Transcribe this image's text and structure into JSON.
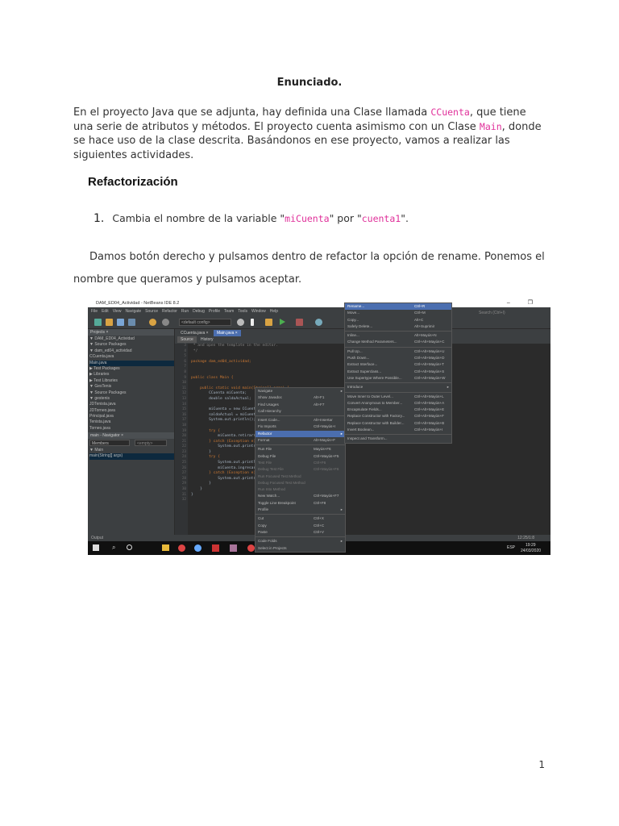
{
  "document": {
    "title": "Enunciado.",
    "para1": {
      "t1": "En el proyecto Java que se adjunta, hay definida una Clase llamada ",
      "c1": "CCuenta",
      "t2": ", que tiene una serie de atributos y métodos. El proyecto cuenta asimismo con un Clase ",
      "c2": "Main",
      "t3": ", donde se hace uso de la clase descrita. Basándonos en ese proyecto, vamos a realizar las siguientes actividades."
    },
    "heading": "Refactorización",
    "item1": {
      "number": "1.",
      "t1": "Cambia el nombre de la variable \"",
      "c1": "miCuenta",
      "t2": "\" por \"",
      "c2": "cuenta1",
      "t3": "\"."
    },
    "para2": "Damos botón derecho y pulsamos dentro de refactor la opción de rename. Ponemos el nombre que queramos y pulsamos aceptar.",
    "page_number": "1"
  },
  "screenshot": {
    "window_title": "DAM_ED04_Actividad - NetBeans IDE 8.2",
    "window_controls": "– ❐",
    "menu": [
      "File",
      "Edit",
      "View",
      "Navigate",
      "Source",
      "Refactor",
      "Run",
      "Debug",
      "Profile",
      "Team",
      "Tools",
      "Window",
      "Help"
    ],
    "config": "<default config>",
    "search_placeholder": "Search (Ctrl+I)",
    "projects_tab": "Projects ×",
    "project_tree": [
      "▼ DAM_ED04_Actividad",
      "  ▼ Source Packages",
      "    ▼ dam_ed04_actividad",
      "       CCuenta.java",
      "       Main.java",
      "  ▶ Test Packages",
      "  ▶ Libraries",
      "  ▶ Test Libraries",
      "▼ GesTenis",
      "  ▼ Source Packages",
      "    ▼ gestenis",
      "       JDTenista.java",
      "       JDTorneo.java",
      "       Principal.java",
      "       Tenista.java",
      "       Torneo.java"
    ],
    "navigator_tab": "main - Navigator ×",
    "navigator_members": "Members",
    "navigator_empty": "<empty>",
    "navigator_tree": [
      "▼ Main",
      "    main(String[] args)"
    ],
    "editor_tabs": [
      "CCuenta.java ×",
      "Main.java ×"
    ],
    "source_tab": "Source",
    "history_tab": "History",
    "line_numbers": [
      "3",
      "4",
      "5",
      "6",
      "7",
      "8",
      "9",
      "10",
      "11",
      "12",
      "13",
      "14",
      "15",
      "16",
      "17",
      "18",
      "19",
      "20",
      "21",
      "22",
      "23",
      "24",
      "25",
      "26",
      "27",
      "28",
      "29",
      "30",
      "31",
      "32"
    ],
    "code_lines": [
      " * and open the template in the editor.",
      " */",
      "",
      "package dam_ed04_actividad;",
      "",
      "",
      "public class Main {",
      "",
      "    public static void main(String[] args) {",
      "        CCuenta miCuenta;",
      "        double saldoActual;",
      "",
      "        miCuenta = new CCuenta();",
      "        saldoActual = miCuenta.estado();",
      "        System.out.println();",
      "",
      "        try {",
      "            miCuenta.retirar();",
      "        } catch (Exception e) {",
      "            System.out.print();",
      "        }",
      "        try {",
      "            System.out.println();",
      "            miCuenta.ingresar();",
      "        } catch (Exception e) {",
      "            System.out.print();",
      "        }",
      "    }",
      "}",
      ""
    ],
    "context_menu": [
      {
        "label": "Navigate",
        "arrow": "▸"
      },
      {
        "label": "Show Javadoc",
        "shortcut": "Alt+F1"
      },
      {
        "label": "Find Usages",
        "shortcut": "Alt+F7"
      },
      {
        "label": "Call Hierarchy"
      },
      {
        "sep": true
      },
      {
        "label": "Insert Code...",
        "shortcut": "Alt+Insertar"
      },
      {
        "label": "Fix Imports",
        "shortcut": "Ctrl+Mayús+I"
      },
      {
        "label": "Refactor",
        "arrow": "▸",
        "highlight": true
      },
      {
        "label": "Format",
        "shortcut": "Alt+Mayús+F"
      },
      {
        "sep": true
      },
      {
        "label": "Run File",
        "shortcut": "Mayús+F6"
      },
      {
        "label": "Debug File",
        "shortcut": "Ctrl+Mayús+F5"
      },
      {
        "label": "Test File",
        "shortcut": "Ctrl+F6",
        "disabled": true
      },
      {
        "label": "Debug Test File",
        "shortcut": "Ctrl+Mayús+F6",
        "disabled": true
      },
      {
        "label": "Run Focused Test Method",
        "disabled": true
      },
      {
        "label": "Debug Focused Test Method",
        "disabled": true
      },
      {
        "label": "Run Into Method",
        "disabled": true
      },
      {
        "label": "New Watch...",
        "shortcut": "Ctrl+Mayús+F7"
      },
      {
        "label": "Toggle Line Breakpoint",
        "shortcut": "Ctrl+F8"
      },
      {
        "label": "Profile",
        "arrow": "▸"
      },
      {
        "sep": true
      },
      {
        "label": "Cut",
        "shortcut": "Ctrl+X"
      },
      {
        "label": "Copy",
        "shortcut": "Ctrl+C"
      },
      {
        "label": "Paste",
        "shortcut": "Ctrl+V"
      },
      {
        "sep": true
      },
      {
        "label": "Code Folds",
        "arrow": "▸"
      },
      {
        "label": "Select in Projects"
      }
    ],
    "refactor_submenu": [
      {
        "label": "Rename...",
        "shortcut": "Ctrl+R",
        "highlight": true
      },
      {
        "label": "Move...",
        "shortcut": "Ctrl+M"
      },
      {
        "label": "Copy...",
        "shortcut": "Alt+C"
      },
      {
        "label": "Safely Delete...",
        "shortcut": "Alt+Suprimir"
      },
      {
        "sep": true
      },
      {
        "label": "Inline...",
        "shortcut": "Alt+Mayús+N"
      },
      {
        "label": "Change Method Parameters...",
        "shortcut": "Ctrl+Alt+Mayús+C"
      },
      {
        "sep": true
      },
      {
        "label": "Pull Up...",
        "shortcut": "Ctrl+Alt+Mayús+U"
      },
      {
        "label": "Push Down...",
        "shortcut": "Ctrl+Alt+Mayús+D"
      },
      {
        "label": "Extract Interface...",
        "shortcut": "Ctrl+Alt+Mayús+T"
      },
      {
        "label": "Extract Superclass...",
        "shortcut": "Ctrl+Alt+Mayús+S"
      },
      {
        "label": "Use Supertype Where Possible...",
        "shortcut": "Ctrl+Alt+Mayús+W"
      },
      {
        "sep": true
      },
      {
        "label": "Introduce",
        "arrow": "▸"
      },
      {
        "sep": true
      },
      {
        "label": "Move Inner to Outer Level...",
        "shortcut": "Ctrl+Alt+Mayús+L"
      },
      {
        "label": "Convert Anonymous to Member...",
        "shortcut": "Ctrl+Alt+Mayús+A"
      },
      {
        "label": "Encapsulate Fields...",
        "shortcut": "Ctrl+Alt+Mayús+E"
      },
      {
        "label": "Replace Constructor with Factory...",
        "shortcut": "Ctrl+Alt+Mayús+F"
      },
      {
        "label": "Replace Constructor with Builder...",
        "shortcut": "Ctrl+Alt+Mayús+B"
      },
      {
        "label": "Invert Boolean...",
        "shortcut": "Ctrl+Alt+Mayús+I"
      },
      {
        "sep": true
      },
      {
        "label": "Inspect and Transform..."
      }
    ],
    "output_tab": "Output",
    "cursor_position": "12:25/1:8",
    "tray_lang": "ESP",
    "tray_time": "19:29",
    "tray_date": "24/03/2020"
  }
}
